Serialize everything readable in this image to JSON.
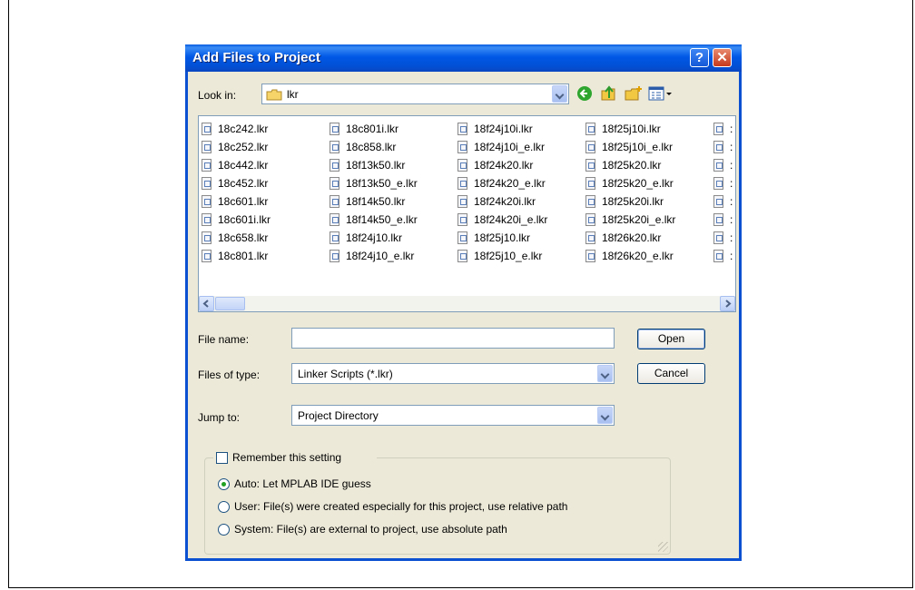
{
  "window": {
    "title": "Add Files to Project",
    "help_label": "?",
    "close_label": "✕"
  },
  "look_in": {
    "label": "Look in:",
    "value": "lkr",
    "toolbar_icons": [
      "back-icon",
      "up-folder-icon",
      "new-folder-icon",
      "view-menu-icon"
    ]
  },
  "files": {
    "columns": [
      [
        "18c242.lkr",
        "18c252.lkr",
        "18c442.lkr",
        "18c452.lkr",
        "18c601.lkr",
        "18c601i.lkr",
        "18c658.lkr",
        "18c801.lkr"
      ],
      [
        "18c801i.lkr",
        "18c858.lkr",
        "18f13k50.lkr",
        "18f13k50_e.lkr",
        "18f14k50.lkr",
        "18f14k50_e.lkr",
        "18f24j10.lkr",
        "18f24j10_e.lkr"
      ],
      [
        "18f24j10i.lkr",
        "18f24j10i_e.lkr",
        "18f24k20.lkr",
        "18f24k20_e.lkr",
        "18f24k20i.lkr",
        "18f24k20i_e.lkr",
        "18f25j10.lkr",
        "18f25j10_e.lkr"
      ],
      [
        "18f25j10i.lkr",
        "18f25j10i_e.lkr",
        "18f25k20.lkr",
        "18f25k20_e.lkr",
        "18f25k20i.lkr",
        "18f25k20i_e.lkr",
        "18f26k20.lkr",
        "18f26k20_e.lkr"
      ],
      [
        ":",
        ":",
        ":",
        ":",
        ":",
        ":",
        ":",
        ":"
      ]
    ]
  },
  "file_name": {
    "label": "File name:",
    "value": ""
  },
  "files_of_type": {
    "label": "Files of type:",
    "value": "Linker Scripts (*.lkr)"
  },
  "jump_to": {
    "label": "Jump to:",
    "value": "Project Directory"
  },
  "buttons": {
    "open": "Open",
    "cancel": "Cancel"
  },
  "remember": {
    "label": "Remember this setting",
    "checked": false,
    "options": [
      {
        "label": "Auto: Let MPLAB IDE guess",
        "selected": true
      },
      {
        "label": "User: File(s) were created especially for this project, use relative path",
        "selected": false
      },
      {
        "label": "System: File(s) are external to project, use absolute path",
        "selected": false
      }
    ]
  }
}
